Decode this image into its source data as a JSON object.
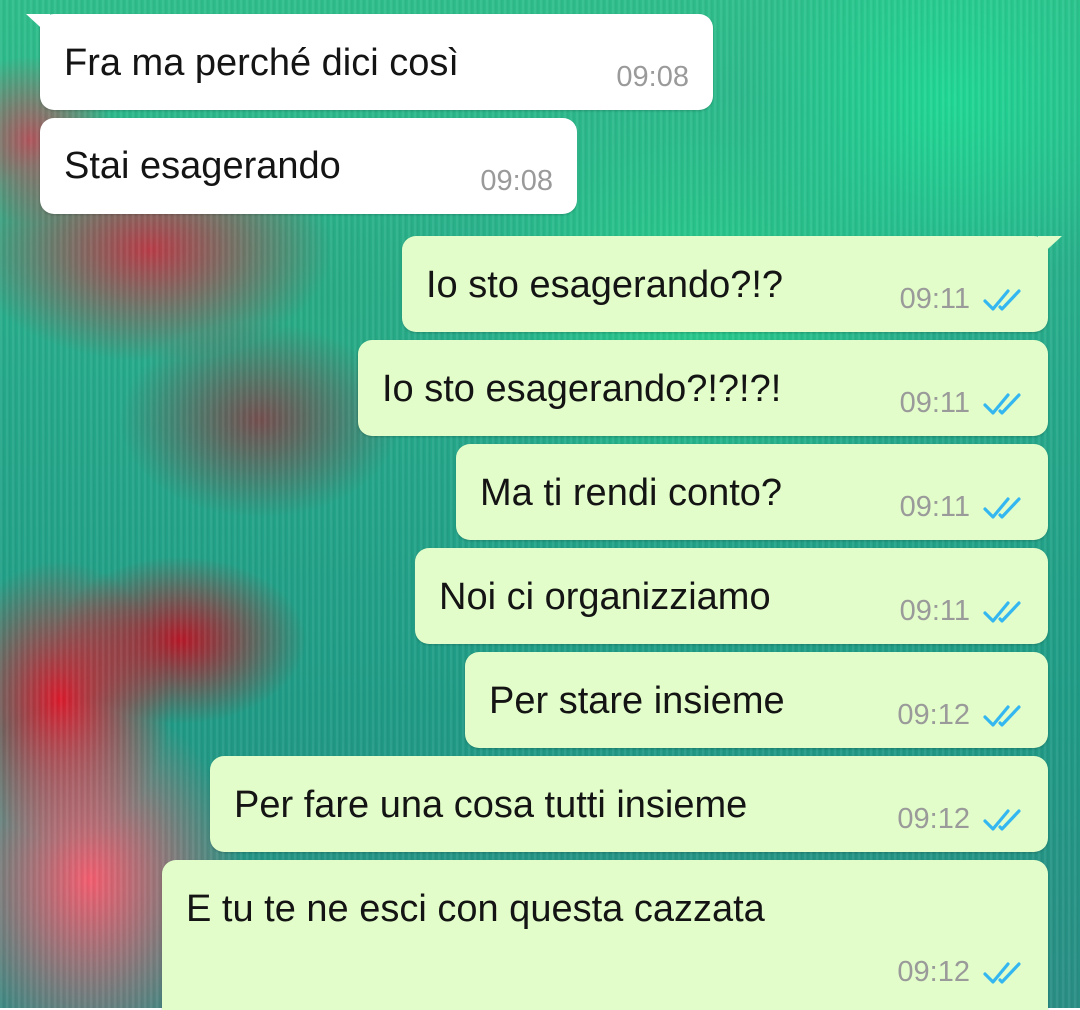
{
  "chat": {
    "messages": [
      {
        "direction": "incoming",
        "text": "Fra ma perché dici così",
        "time": "09:08"
      },
      {
        "direction": "incoming",
        "text": "Stai esagerando",
        "time": "09:08"
      },
      {
        "direction": "outgoing",
        "text": "Io sto esagerando?!?",
        "time": "09:11",
        "status": "read"
      },
      {
        "direction": "outgoing",
        "text": "Io sto esagerando?!?!?!",
        "time": "09:11",
        "status": "read"
      },
      {
        "direction": "outgoing",
        "text": "Ma ti rendi conto?",
        "time": "09:11",
        "status": "read"
      },
      {
        "direction": "outgoing",
        "text": "Noi ci organizziamo",
        "time": "09:11",
        "status": "read"
      },
      {
        "direction": "outgoing",
        "text": "Per stare insieme",
        "time": "09:12",
        "status": "read"
      },
      {
        "direction": "outgoing",
        "text": "Per fare una cosa tutti insieme",
        "time": "09:12",
        "status": "read"
      },
      {
        "direction": "outgoing",
        "text": "E tu te ne esci con questa cazzata",
        "time": "09:12",
        "status": "read"
      }
    ]
  },
  "colors": {
    "incoming_bubble": "#ffffff",
    "outgoing_bubble": "#e2fdc9",
    "read_ticks": "#34b7f1",
    "timestamp": "#9a9a9a"
  },
  "icons": {
    "read_status": "double-check-icon"
  }
}
